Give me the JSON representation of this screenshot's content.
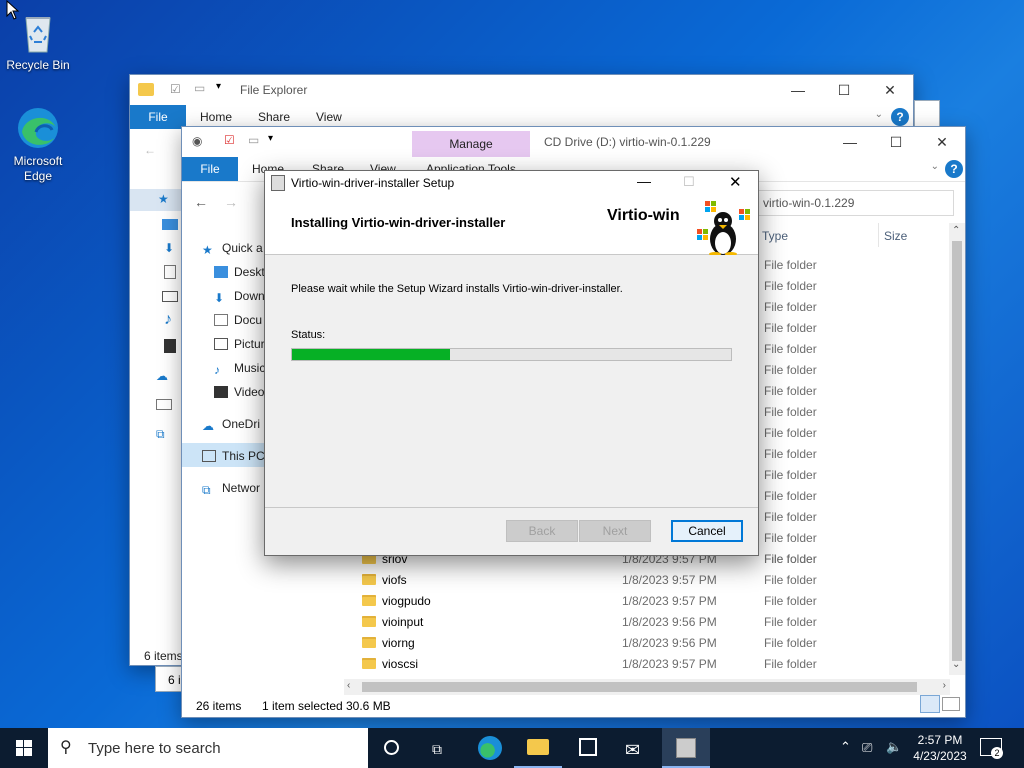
{
  "desktop": {
    "icons": [
      {
        "label": "Recycle Bin"
      },
      {
        "label": "Microsoft Edge"
      }
    ]
  },
  "explorer_back": {
    "title": "File Explorer",
    "tabs": {
      "file": "File",
      "home": "Home",
      "share": "Share",
      "view": "View"
    },
    "status": "6 items",
    "status2": "6 i"
  },
  "explorer_front": {
    "title": "CD Drive (D:) virtio-win-0.1.229",
    "manage_tab": "Manage",
    "app_tools_tab": "Application Tools",
    "tabs": {
      "file": "File",
      "home": "Home",
      "share": "Share",
      "view": "View"
    },
    "address": "virtio-win-0.1.229",
    "columns": {
      "type": "Type",
      "size": "Size"
    },
    "nav": [
      {
        "label": "Quick a"
      },
      {
        "label": "Deskt"
      },
      {
        "label": "Down"
      },
      {
        "label": "Docu"
      },
      {
        "label": "Pictur"
      },
      {
        "label": "Music"
      },
      {
        "label": "Video"
      },
      {
        "label": "OneDri"
      },
      {
        "label": "This PC"
      },
      {
        "label": "Networ"
      }
    ],
    "type_only_rows": [
      "File folder",
      "File folder",
      "File folder",
      "File folder",
      "File folder",
      "File folder",
      "File folder",
      "File folder",
      "File folder",
      "File folder",
      "File folder",
      "File folder",
      "File folder",
      "File folder",
      "File folder"
    ],
    "rows": [
      {
        "name": "sriov",
        "date": "1/8/2023 9:57 PM",
        "type": "File folder"
      },
      {
        "name": "viofs",
        "date": "1/8/2023 9:57 PM",
        "type": "File folder"
      },
      {
        "name": "viogpudo",
        "date": "1/8/2023 9:57 PM",
        "type": "File folder"
      },
      {
        "name": "vioinput",
        "date": "1/8/2023 9:56 PM",
        "type": "File folder"
      },
      {
        "name": "viorng",
        "date": "1/8/2023 9:56 PM",
        "type": "File folder"
      },
      {
        "name": "vioscsi",
        "date": "1/8/2023 9:57 PM",
        "type": "File folder"
      }
    ],
    "status_items": "26 items",
    "status_selected": "1 item selected",
    "status_size": "30.6 MB"
  },
  "installer": {
    "title": "Virtio-win-driver-installer Setup",
    "heading": "Installing Virtio-win-driver-installer",
    "brand": "Virtio-win",
    "message": "Please wait while the Setup Wizard installs Virtio-win-driver-installer.",
    "status_label": "Status:",
    "progress": 0.36,
    "progress_color": "#06b025",
    "buttons": {
      "back": "Back",
      "next": "Next",
      "cancel": "Cancel"
    }
  },
  "taskbar": {
    "search_placeholder": "Type here to search",
    "time": "2:57 PM",
    "date": "4/23/2023",
    "notifications": "2"
  }
}
